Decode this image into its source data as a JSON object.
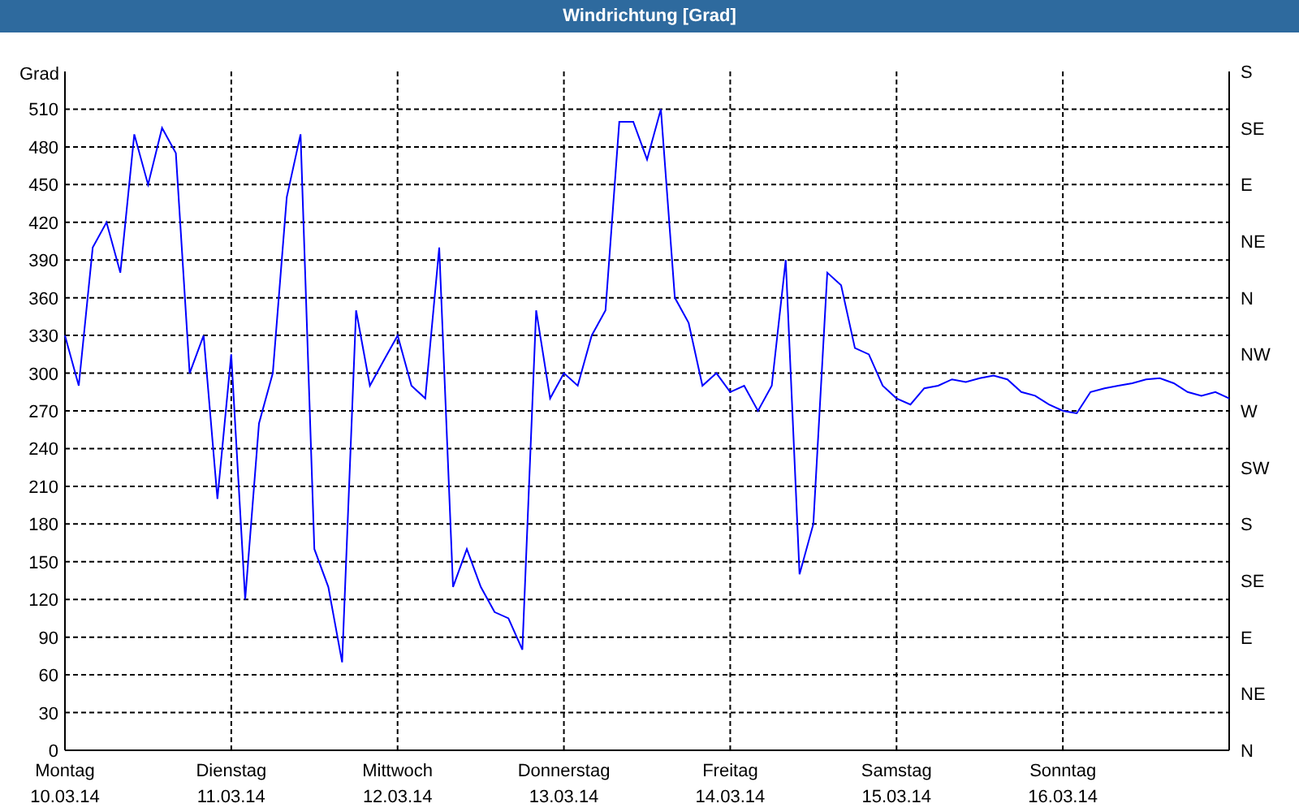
{
  "window": {
    "title": "Windrichtung [Grad]"
  },
  "chart": {
    "x_dates": [
      "10.03.14",
      "11.03.14",
      "12.03.14",
      "13.03.14",
      "14.03.14",
      "15.03.14",
      "16.03.14"
    ],
    "compass_labels": [
      "S",
      "SE",
      "E",
      "NE",
      "N",
      "NW",
      "W",
      "SW",
      "S",
      "SE",
      "E",
      "NE",
      "N"
    ],
    "chart_data": {
      "type": "line",
      "ylabel": "Grad",
      "ylim": [
        0,
        540
      ],
      "grid": true,
      "categories": [
        "Montag",
        null,
        null,
        null,
        null,
        null,
        null,
        null,
        null,
        null,
        null,
        null,
        "Dienstag",
        null,
        null,
        null,
        null,
        null,
        null,
        null,
        null,
        null,
        null,
        null,
        "Mittwoch",
        null,
        null,
        null,
        null,
        null,
        null,
        null,
        null,
        null,
        null,
        null,
        "Donnerstag",
        null,
        null,
        null,
        null,
        null,
        null,
        null,
        null,
        null,
        null,
        null,
        "Freitag",
        null,
        null,
        null,
        null,
        null,
        null,
        null,
        null,
        null,
        null,
        null,
        "Samstag",
        null,
        null,
        null,
        null,
        null,
        null,
        null,
        null,
        null,
        null,
        null,
        "Sonntag",
        null,
        null,
        null,
        null,
        null,
        null,
        null,
        null,
        null,
        null,
        null,
        null
      ],
      "yticks": [
        0,
        30,
        60,
        90,
        120,
        150,
        180,
        210,
        240,
        270,
        300,
        330,
        360,
        390,
        420,
        450,
        480,
        510
      ],
      "series": [
        {
          "color": "#0000ff",
          "values": [
            330,
            290,
            400,
            420,
            380,
            490,
            450,
            495,
            475,
            300,
            330,
            200,
            315,
            120,
            260,
            300,
            440,
            490,
            160,
            130,
            70,
            350,
            290,
            310,
            330,
            290,
            280,
            400,
            130,
            160,
            130,
            110,
            105,
            80,
            350,
            280,
            300,
            290,
            330,
            350,
            500,
            500,
            470,
            510,
            360,
            340,
            290,
            300,
            285,
            290,
            270,
            290,
            390,
            140,
            180,
            380,
            370,
            320,
            315,
            290,
            280,
            275,
            288,
            290,
            295,
            293,
            296,
            298,
            295,
            285,
            282,
            275,
            270,
            268,
            285,
            288,
            290,
            292,
            295,
            296,
            292,
            285,
            282,
            285,
            280
          ]
        }
      ]
    }
  }
}
